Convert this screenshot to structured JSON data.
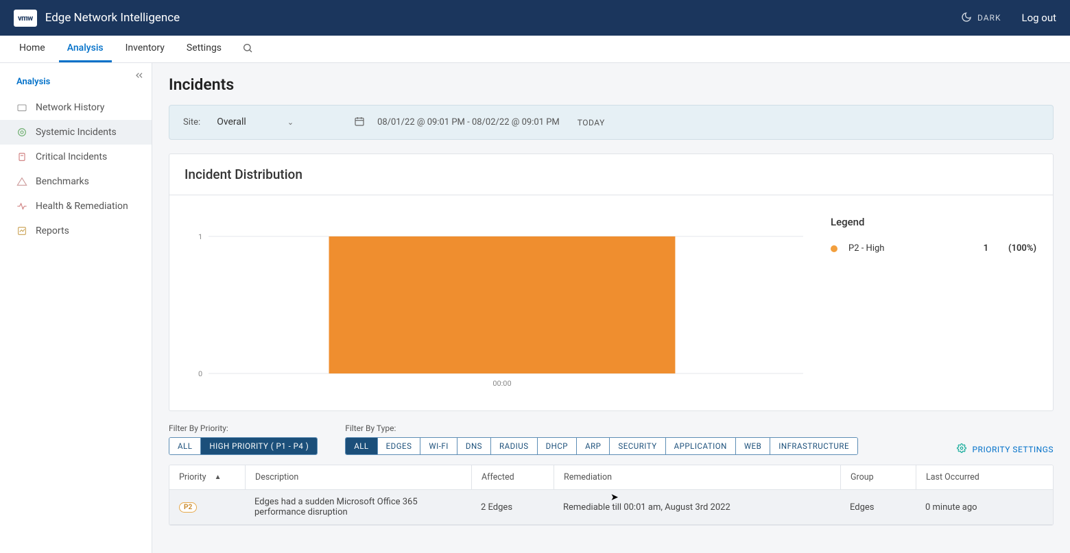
{
  "brand": {
    "logo_text": "vmw",
    "app_title": "Edge Network Intelligence"
  },
  "header": {
    "dark_label": "DARK",
    "logout_label": "Log out"
  },
  "tabs": [
    "Home",
    "Analysis",
    "Inventory",
    "Settings"
  ],
  "active_tab": "Analysis",
  "sidebar": {
    "section_title": "Analysis",
    "items": [
      "Network History",
      "Systemic Incidents",
      "Critical Incidents",
      "Benchmarks",
      "Health & Remediation",
      "Reports"
    ],
    "active_index": 1
  },
  "page": {
    "title": "Incidents"
  },
  "filters": {
    "site_label": "Site:",
    "site_value": "Overall",
    "date_range": "08/01/22 @ 09:01 PM - 08/02/22 @ 09:01 PM",
    "today_label": "TODAY"
  },
  "distribution": {
    "card_title": "Incident Distribution",
    "legend_title": "Legend",
    "legend_items": [
      {
        "label": "P2 - High",
        "count": "1",
        "pct": "(100%)",
        "color": "#f29f3d"
      }
    ]
  },
  "chart_data": {
    "type": "bar",
    "title": "Incident Distribution",
    "categories": [
      "00:00"
    ],
    "ylim": [
      0,
      1
    ],
    "yticks": [
      0,
      1
    ],
    "series": [
      {
        "name": "P2 - High",
        "values": [
          1
        ],
        "color": "#f29f3d"
      }
    ]
  },
  "filter_priority": {
    "label": "Filter By Priority:",
    "options": [
      "ALL",
      "HIGH PRIORITY ( P1 - P4 )"
    ],
    "active_index": 1
  },
  "filter_type": {
    "label": "Filter By Type:",
    "options": [
      "ALL",
      "EDGES",
      "WI-FI",
      "DNS",
      "RADIUS",
      "DHCP",
      "ARP",
      "SECURITY",
      "APPLICATION",
      "WEB",
      "INFRASTRUCTURE"
    ],
    "active_index": 0
  },
  "priority_settings_label": "PRIORITY SETTINGS",
  "table": {
    "columns": [
      "Priority",
      "Description",
      "Affected",
      "Remediation",
      "Group",
      "Last Occurred"
    ],
    "rows": [
      {
        "priority_badge": "P2",
        "description": "Edges had a sudden Microsoft Office 365 performance disruption",
        "affected": "2 Edges",
        "remediation": "Remediable till 00:01 am, August 3rd 2022",
        "group": "Edges",
        "last_occurred": "0 minute ago"
      }
    ]
  }
}
